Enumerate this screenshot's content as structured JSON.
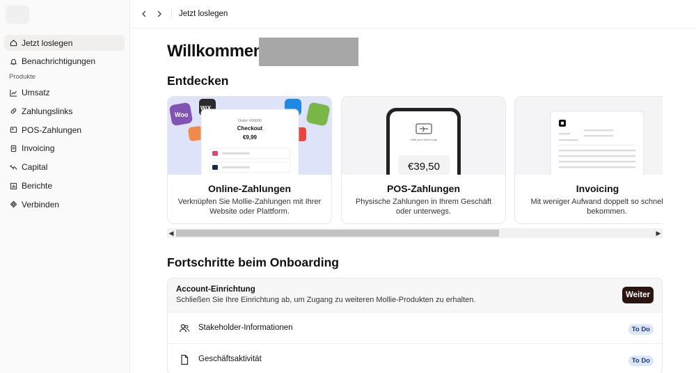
{
  "sidebar": {
    "items_top": [
      {
        "label": "Jetzt loslegen",
        "icon": "home-icon",
        "active": true
      },
      {
        "label": "Benachrichtigungen",
        "icon": "bell-icon"
      }
    ],
    "section_label": "Produkte",
    "items_products": [
      {
        "label": "Umsatz",
        "icon": "chart-line-icon"
      },
      {
        "label": "Zahlungslinks",
        "icon": "link-icon"
      },
      {
        "label": "POS-Zahlungen",
        "icon": "pos-terminal-icon"
      },
      {
        "label": "Invoicing",
        "icon": "document-icon"
      },
      {
        "label": "Capital",
        "icon": "capital-icon"
      },
      {
        "label": "Berichte",
        "icon": "report-icon"
      },
      {
        "label": "Verbinden",
        "icon": "puzzle-icon"
      }
    ]
  },
  "topbar": {
    "title": "Jetzt loslegen"
  },
  "main": {
    "welcome": "Willkommen,",
    "discover_heading": "Entdecken",
    "cards": [
      {
        "title": "Online-Zahlungen",
        "desc": "Verknüpfen Sie Mollie-Zahlungen mit Ihrer Website oder Plattform.",
        "illus": {
          "order": "Order #00000",
          "checkout": "Checkout",
          "amount": "€9,99",
          "badge_woo": "Woo",
          "badge_wix": "WiX"
        }
      },
      {
        "title": "POS-Zahlungen",
        "desc": "Physische Zahlungen in Ihrem Geschäft oder unterwegs.",
        "illus": {
          "amount": "€39,50",
          "hint": "Hold your card to pay"
        }
      },
      {
        "title": "Invoicing",
        "desc": "Mit weniger Aufwand doppelt so schnell Geld bekommen."
      }
    ],
    "onboarding_heading": "Fortschritte beim Onboarding",
    "onboarding": {
      "title": "Account-Einrichtung",
      "subtitle": "Schließen Sie Ihre Einrichtung ab, um Zugang zu weiteren Mollie-Produkten zu erhalten.",
      "button": "Weiter",
      "rows": [
        {
          "label": "Stakeholder-Informationen",
          "status": "To Do",
          "icon": "users-icon"
        },
        {
          "label": "Geschäftsaktivität",
          "status": "To Do",
          "icon": "file-icon"
        }
      ]
    }
  },
  "colors": {
    "accent_button": "#2c1410",
    "badge_bg": "#dbe6fb",
    "badge_text": "#1e3a6e",
    "card_illus_bg": "#dfe3fa"
  }
}
